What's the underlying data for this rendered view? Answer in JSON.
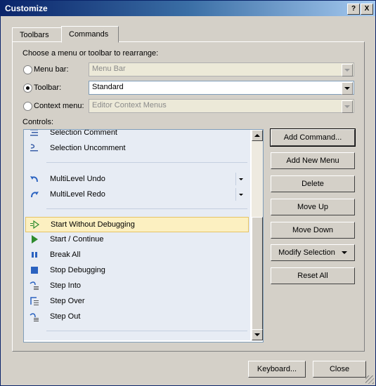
{
  "window": {
    "title": "Customize",
    "help_btn": "?",
    "close_btn": "X"
  },
  "tabs": [
    {
      "label": "Toolbars"
    },
    {
      "label": "Commands"
    }
  ],
  "rearrange_label": "Choose a menu or toolbar to rearrange:",
  "options": {
    "menu_bar": {
      "label": "Menu bar:",
      "value": "Menu Bar",
      "selected": false
    },
    "toolbar": {
      "label": "Toolbar:",
      "value": "Standard",
      "selected": true
    },
    "context_menu": {
      "label": "Context menu:",
      "value": "Editor Context Menus",
      "selected": false
    }
  },
  "controls_label": "Controls:",
  "controls": [
    {
      "label": "Selection Comment",
      "icon": "comment-icon"
    },
    {
      "label": "Selection Uncomment",
      "icon": "uncomment-icon"
    },
    {
      "label": "MultiLevel Undo",
      "icon": "undo-icon"
    },
    {
      "label": "MultiLevel Redo",
      "icon": "redo-icon"
    },
    {
      "label": "Start Without Debugging",
      "icon": "start-without-debugging-icon",
      "selected": true
    },
    {
      "label": "Start / Continue",
      "icon": "play-icon"
    },
    {
      "label": "Break All",
      "icon": "pause-icon"
    },
    {
      "label": "Stop Debugging",
      "icon": "stop-icon"
    },
    {
      "label": "Step Into",
      "icon": "step-into-icon"
    },
    {
      "label": "Step Over",
      "icon": "step-over-icon"
    },
    {
      "label": "Step Out",
      "icon": "step-out-icon"
    }
  ],
  "side_buttons": {
    "add_command": "Add Command...",
    "add_new_menu": "Add New Menu",
    "delete": "Delete",
    "move_up": "Move Up",
    "move_down": "Move Down",
    "modify_selection": "Modify Selection",
    "reset_all": "Reset All"
  },
  "footer": {
    "keyboard": "Keyboard...",
    "close": "Close"
  },
  "colors": {
    "title_start": "#0a246a",
    "title_end": "#a6caf0",
    "selection": "#fcf0c1",
    "list_bg": "#e7ecf4"
  }
}
